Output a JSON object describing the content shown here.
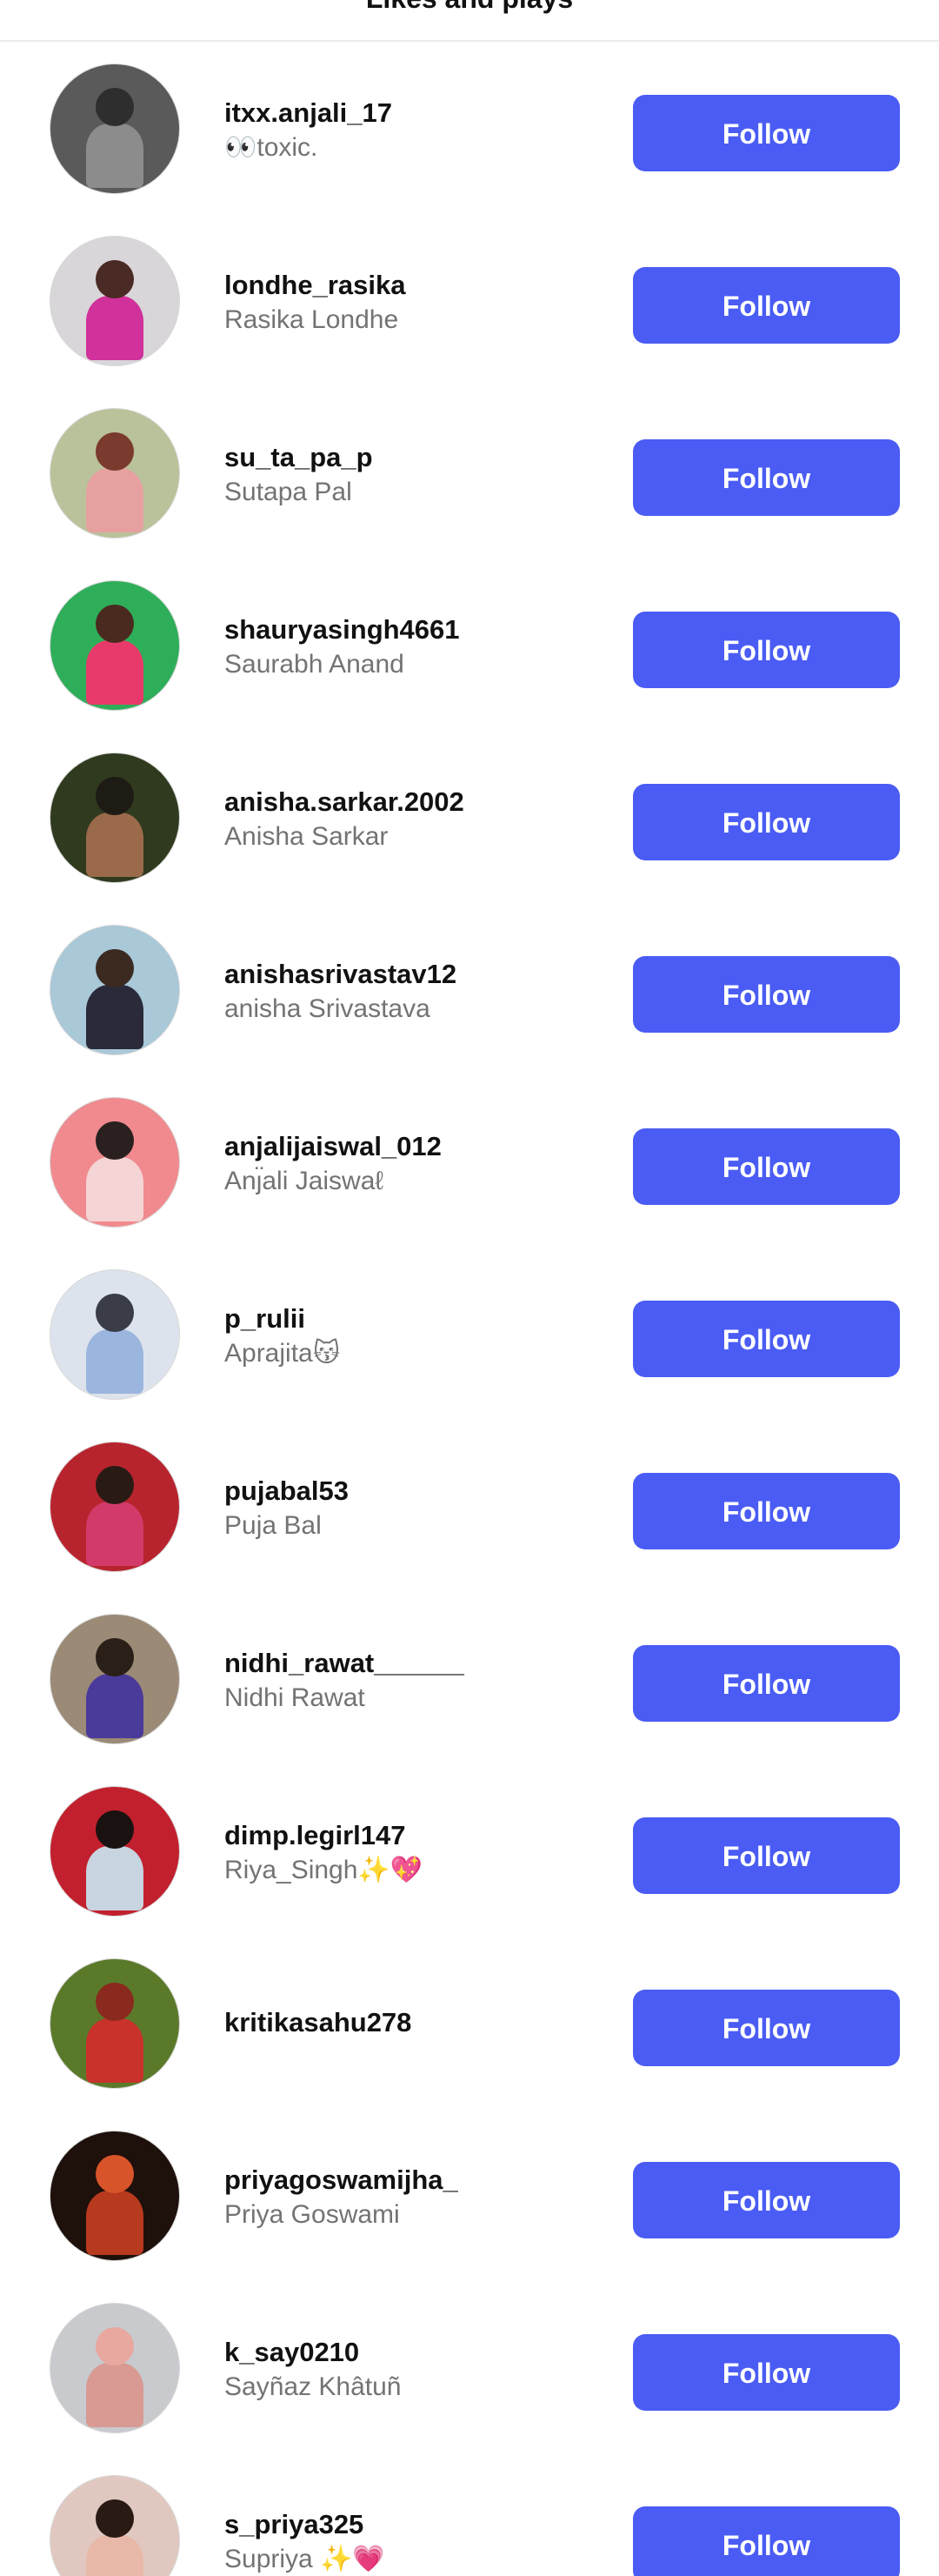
{
  "header": {
    "title": "Likes and plays"
  },
  "colors": {
    "follow_button": "#4a5cf4",
    "username": "#111111",
    "fullname": "#737373"
  },
  "users": [
    {
      "username": "itxx.anjali_17",
      "fullname": "👀toxic.",
      "button": "Follow",
      "avatar": {
        "bg": "#5a5a5a",
        "head": "#2e2e2e",
        "body": "#8c8c8c"
      }
    },
    {
      "username": "londhe_rasika",
      "fullname": "Rasika Londhe",
      "button": "Follow",
      "avatar": {
        "bg": "#d9d6da",
        "head": "#4a2a24",
        "body": "#d0319a"
      }
    },
    {
      "username": "su_ta_pa_p",
      "fullname": "Sutapa Pal",
      "button": "Follow",
      "avatar": {
        "bg": "#b9c29a",
        "head": "#7a3a2e",
        "body": "#e7a0a0"
      }
    },
    {
      "username": "shauryasingh4661",
      "fullname": "Saurabh Anand",
      "button": "Follow",
      "avatar": {
        "bg": "#2fae5a",
        "head": "#4a2a1e",
        "body": "#e83a6a"
      }
    },
    {
      "username": "anisha.sarkar.2002",
      "fullname": "Anisha Sarkar",
      "button": "Follow",
      "avatar": {
        "bg": "#2f3a1e",
        "head": "#1e1a14",
        "body": "#9a6a4a"
      }
    },
    {
      "username": "anishasrivastav12",
      "fullname": "anisha Srivastava",
      "button": "Follow",
      "avatar": {
        "bg": "#a9c8d8",
        "head": "#3a2a20",
        "body": "#2a2a3a"
      }
    },
    {
      "username": "anjalijaiswal_012",
      "fullname": "Anȷ̈ali Jaiswaℓ",
      "button": "Follow",
      "avatar": {
        "bg": "#f08a8e",
        "head": "#2a2020",
        "body": "#f4d4d4"
      }
    },
    {
      "username": "p_rulii",
      "fullname": "Aprajita😽",
      "button": "Follow",
      "avatar": {
        "bg": "#dde3ec",
        "head": "#3a3c48",
        "body": "#9bb6de"
      }
    },
    {
      "username": "pujabal53",
      "fullname": "Puja Bal",
      "button": "Follow",
      "avatar": {
        "bg": "#b8242e",
        "head": "#2a1a14",
        "body": "#d23a6a"
      }
    },
    {
      "username": "nidhi_rawat______",
      "fullname": "Nidhi Rawat",
      "button": "Follow",
      "avatar": {
        "bg": "#9a8a76",
        "head": "#2a2018",
        "body": "#4a3a9a"
      }
    },
    {
      "username": "dimp.legirl147",
      "fullname": "Riya_Singh✨💖",
      "button": "Follow",
      "avatar": {
        "bg": "#c2202e",
        "head": "#1a1210",
        "body": "#c8d4e0"
      }
    },
    {
      "username": "kritikasahu278",
      "fullname": "",
      "button": "Follow",
      "avatar": {
        "bg": "#5a7a2a",
        "head": "#8a2a1e",
        "body": "#c8322a"
      }
    },
    {
      "username": "priyagoswamijha_",
      "fullname": "Priya Goswami",
      "button": "Follow",
      "avatar": {
        "bg": "#1e100a",
        "head": "#d8542a",
        "body": "#b83a1e"
      }
    },
    {
      "username": "k_say0210",
      "fullname": "Sayñaz Khâtuñ",
      "button": "Follow",
      "avatar": {
        "bg": "#c8cace",
        "head": "#e8a8a0",
        "body": "#d89a92"
      }
    },
    {
      "username": "s_priya325",
      "fullname": "Supriya ✨💗",
      "button": "Follow",
      "avatar": {
        "bg": "#e0c8c0",
        "head": "#2a1a14",
        "body": "#e8b8a8"
      }
    }
  ]
}
